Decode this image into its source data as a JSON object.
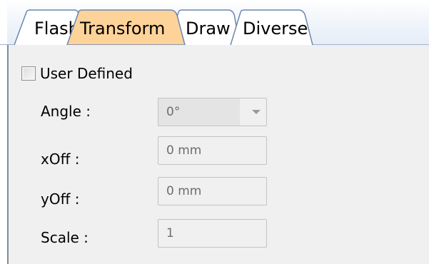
{
  "tabs": [
    {
      "label": "Flash",
      "active": false
    },
    {
      "label": "Transform",
      "active": true
    },
    {
      "label": "Draw",
      "active": false
    },
    {
      "label": "Diverse",
      "active": false
    }
  ],
  "user_defined": {
    "label": "User Defined",
    "checked": false
  },
  "fields": {
    "angle": {
      "label": "Angle :",
      "value": "0°"
    },
    "xoff": {
      "label": "xOff :",
      "value": "0 mm"
    },
    "yoff": {
      "label": "yOff :",
      "value": "0 mm"
    },
    "scale": {
      "label": "Scale :",
      "value": "1"
    }
  },
  "colors": {
    "active_tab": "#fdd39a",
    "inactive_tab": "#ffffff",
    "panel_bg": "#f0f0f0",
    "tab_border": "#6b86b0"
  }
}
